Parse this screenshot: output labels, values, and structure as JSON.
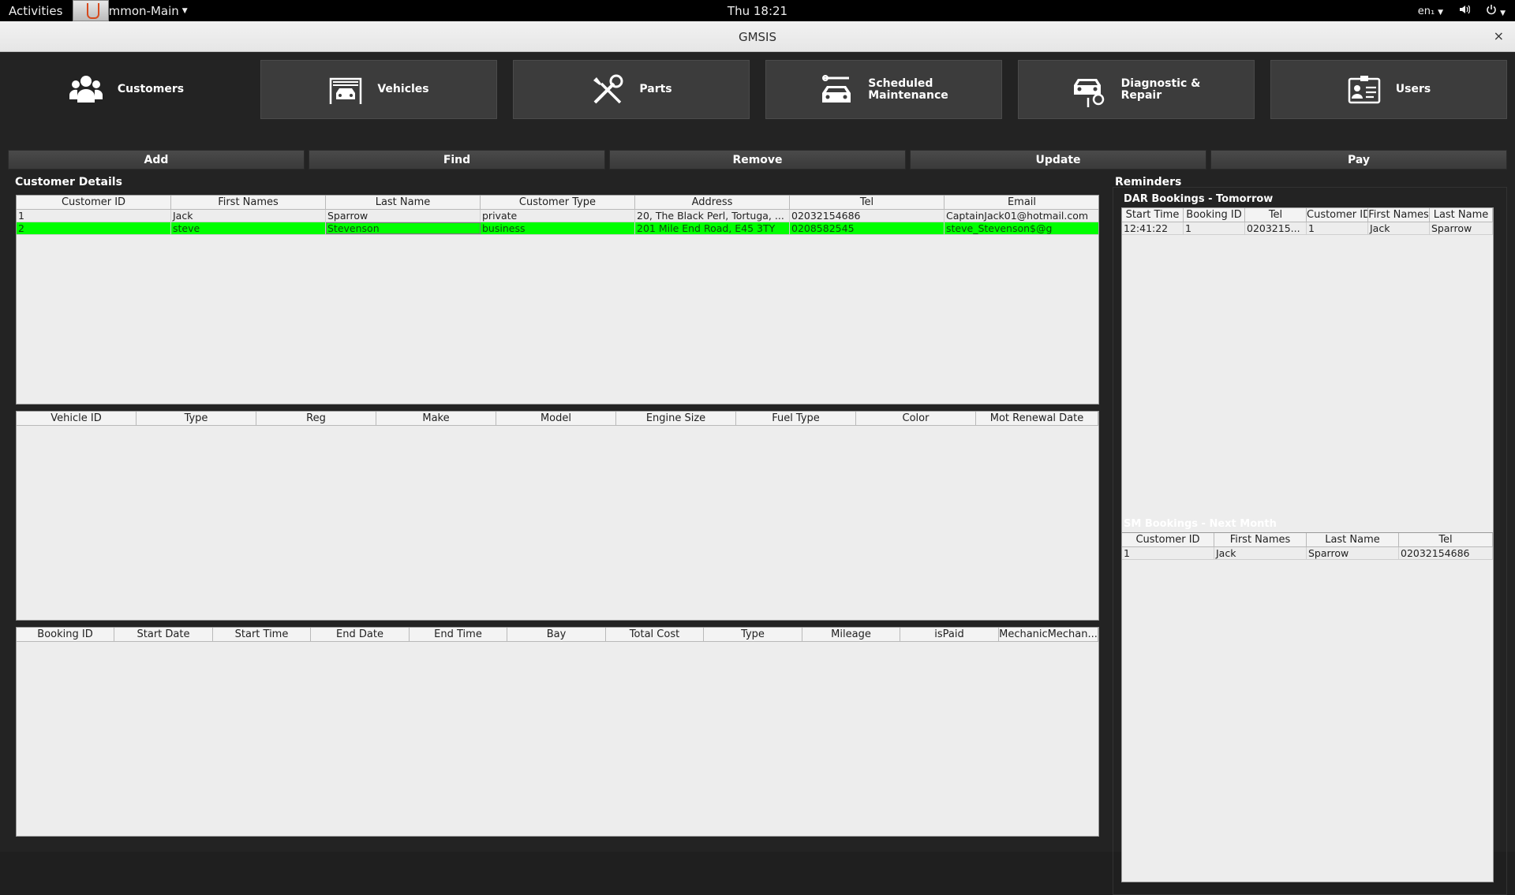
{
  "topbar": {
    "activities": "Activities",
    "app_menu": "Common-Main",
    "clock": "Thu 18:21",
    "lang": "en₁",
    "volume_icon": "speaker-icon",
    "power_icon": "power-icon"
  },
  "window": {
    "title": "GMSIS",
    "close": "×"
  },
  "nav": [
    {
      "label": "Customers",
      "icon": "customers-icon"
    },
    {
      "label": "Vehicles",
      "icon": "vehicle-garage-icon"
    },
    {
      "label": "Parts",
      "icon": "wrench-screwdriver-icon"
    },
    {
      "label": "Scheduled\nMaintenance",
      "icon": "car-service-icon"
    },
    {
      "label": "Diagnostic &\nRepair",
      "icon": "car-repair-icon"
    },
    {
      "label": "Users",
      "icon": "id-card-icon"
    }
  ],
  "actions": [
    "Add",
    "Find",
    "Remove",
    "Update",
    "Pay"
  ],
  "customer_details": {
    "title": "Customer Details",
    "columns": [
      "Customer ID",
      "First Names",
      "Last Name",
      "Customer Type",
      "Address",
      "Tel",
      "Email"
    ],
    "rows": [
      [
        "1",
        "Jack",
        "Sparrow",
        "private",
        "20, The Black Perl, Tortuga, ...",
        "02032154686",
        "CaptainJack01@hotmail.com"
      ],
      [
        "2",
        "steve",
        "Stevenson",
        "business",
        "201 Mile End Road, E45 3TY",
        "0208582545",
        "steve_Stevenson$@g"
      ]
    ],
    "selected_row": 1
  },
  "vehicles_table": {
    "columns": [
      "Vehicle ID",
      "Type",
      "Reg",
      "Make",
      "Model",
      "Engine Size",
      "Fuel Type",
      "Color",
      "Mot Renewal Date"
    ],
    "rows": []
  },
  "bookings_table": {
    "columns": [
      "Booking ID",
      "Start Date",
      "Start Time",
      "End Date",
      "End Time",
      "Bay",
      "Total Cost",
      "Type",
      "Mileage",
      "isPaid",
      "MechanicMechan..."
    ],
    "rows": []
  },
  "reminders": {
    "title": "Reminders",
    "dar": {
      "title": "DAR Bookings - Tomorrow",
      "columns": [
        "Start Time",
        "Booking ID",
        "Tel",
        "Customer ID",
        "First Names",
        "Last Name"
      ],
      "rows": [
        [
          "12:41:22",
          "1",
          "0203215...",
          "1",
          "Jack",
          "Sparrow"
        ]
      ]
    },
    "sm": {
      "title": "SM Bookings - Next Month",
      "columns": [
        "Customer ID",
        "First Names",
        "Last Name",
        "Tel"
      ],
      "rows": [
        [
          "1",
          "Jack",
          "Sparrow",
          "02032154686"
        ]
      ]
    }
  }
}
